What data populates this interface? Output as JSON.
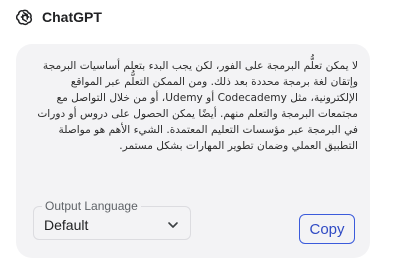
{
  "header": {
    "title": "ChatGPT",
    "logo_icon": "openai-logo-icon"
  },
  "message": {
    "text": "لا يمكن تعلُّم البرمجة على الفور، لكن يجب البدء بتعلم أساسيات البرمجة وإتقان لغة برمجة محددة بعد ذلك. ومن الممكن التعلُّم عبر المواقع الإلكترونية، مثل Codecademy أو Udemy، أو من خلال التواصل مع مجتمعات البرمجة والتعلم منهم. أيضًا يمكن الحصول على دروس أو دورات في البرمجة عبر مؤسسات التعليم المعتمدة. الشيء الأهم هو مواصلة التطبيق العملي وضمان تطوير المهارات بشكل مستمر."
  },
  "output_language": {
    "label": "Output Language",
    "value": "Default",
    "chevron_icon": "chevron-down-icon"
  },
  "actions": {
    "copy_label": "Copy"
  },
  "colors": {
    "card_background": "#f3f3f5",
    "accent": "#3b5bdb",
    "text": "#2d2d2d"
  }
}
